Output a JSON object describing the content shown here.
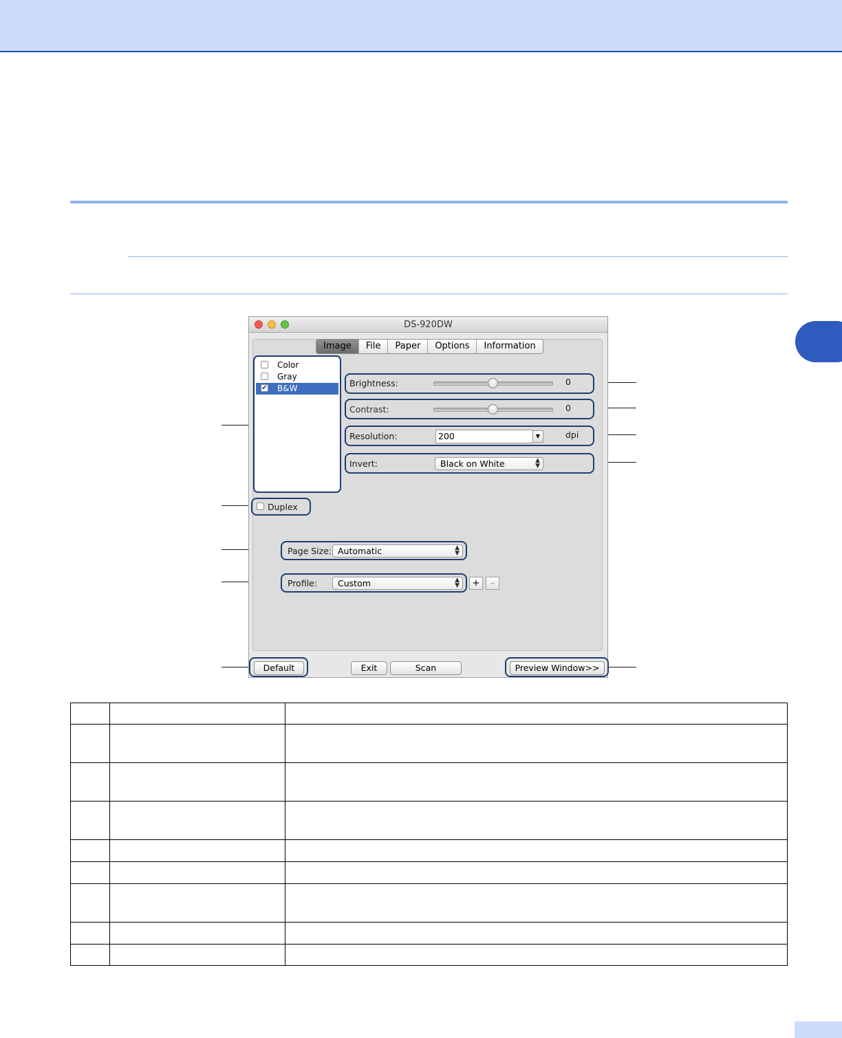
{
  "window": {
    "title": "DS-920DW",
    "tabs": [
      {
        "label": "Image",
        "active": true
      },
      {
        "label": "File",
        "active": false
      },
      {
        "label": "Paper",
        "active": false
      },
      {
        "label": "Options",
        "active": false
      },
      {
        "label": "Information",
        "active": false
      }
    ],
    "color_modes": [
      {
        "label": "Color",
        "checked": false,
        "selected": false
      },
      {
        "label": "Gray",
        "checked": false,
        "selected": false
      },
      {
        "label": "B&W",
        "checked": true,
        "selected": true
      }
    ],
    "brightness": {
      "label": "Brightness:",
      "value": "0"
    },
    "contrast": {
      "label": "Contrast:",
      "value": "0"
    },
    "resolution": {
      "label": "Resolution:",
      "value": "200",
      "unit": "dpi"
    },
    "invert": {
      "label": "Invert:",
      "value": "Black on White"
    },
    "duplex": {
      "label": "Duplex",
      "checked": false
    },
    "page_size": {
      "label": "Page Size:",
      "value": "Automatic"
    },
    "profile": {
      "label": "Profile:",
      "value": "Custom",
      "add_label": "+",
      "remove_label": "–"
    },
    "buttons": {
      "default": "Default",
      "exit": "Exit",
      "scan": "Scan",
      "preview": "Preview Window>>"
    }
  },
  "colors": {
    "accent_band": "#cddcfb",
    "accent_dark": "#1f4fb0",
    "rule": "#8fb0ee",
    "highlight": "#1f3c73"
  },
  "legend_table": {
    "rows": 9
  }
}
